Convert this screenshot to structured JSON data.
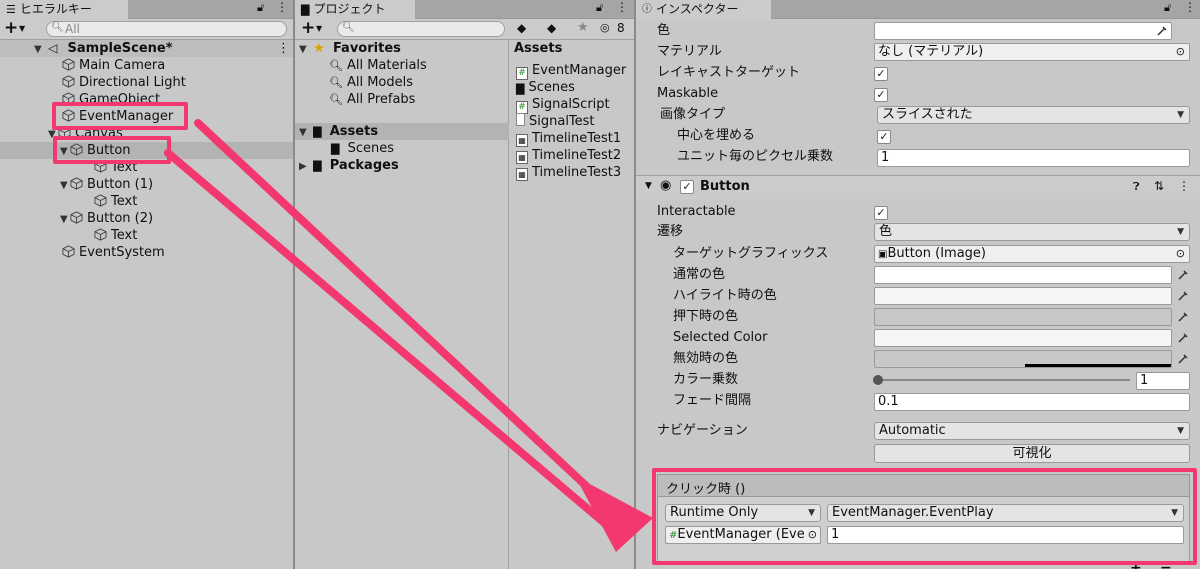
{
  "hierarchy": {
    "tab_label": "ヒエラルキー",
    "add_label": "+",
    "search_placeholder": "All",
    "scene_label": "SampleScene*",
    "items": [
      {
        "label": "Main Camera"
      },
      {
        "label": "Directional Light"
      },
      {
        "label": "GameObject"
      },
      {
        "label": "EventManager"
      },
      {
        "label": "Canvas"
      },
      {
        "label": "Button"
      },
      {
        "label": "Text"
      },
      {
        "label": "Button (1)"
      },
      {
        "label": "Text"
      },
      {
        "label": "Button (2)"
      },
      {
        "label": "Text"
      },
      {
        "label": "EventSystem"
      }
    ]
  },
  "project": {
    "tab_label": "プロジェクト",
    "add_label": "+",
    "badge_count": "8",
    "favorites_label": "Favorites",
    "favorites": [
      "All Materials",
      "All Models",
      "All Prefabs"
    ],
    "assets_label": "Assets",
    "assets_children": [
      "Scenes"
    ],
    "packages_label": "Packages",
    "breadcrumb": "Assets",
    "asset_items": [
      {
        "label": "EventManager",
        "icon": "script-icon"
      },
      {
        "label": "Scenes",
        "icon": "folder-icon"
      },
      {
        "label": "SignalScript",
        "icon": "script-icon"
      },
      {
        "label": "SignalTest",
        "icon": "file-icon"
      },
      {
        "label": "TimelineTest1",
        "icon": "timeline-icon"
      },
      {
        "label": "TimelineTest2",
        "icon": "timeline-icon"
      },
      {
        "label": "TimelineTest3",
        "icon": "timeline-icon"
      }
    ]
  },
  "inspector": {
    "tab_label": "インスペクター",
    "image": {
      "color_label": "色",
      "material_label": "マテリアル",
      "material_value": "なし (マテリアル)",
      "raycast_label": "レイキャストターゲット",
      "maskable_label": "Maskable",
      "image_type_label": "画像タイプ",
      "image_type_value": "スライスされた",
      "fill_center_label": "中心を埋める",
      "ppu_label": "ユニット毎のピクセル乗数",
      "ppu_value": "1"
    },
    "button": {
      "title": "Button",
      "interactable_label": "Interactable",
      "transition_label": "遷移",
      "transition_value": "色",
      "target_graphic_label": "ターゲットグラフィックス",
      "target_graphic_value": "Button (Image)",
      "normal_color_label": "通常の色",
      "highlight_color_label": "ハイライト時の色",
      "pressed_color_label": "押下時の色",
      "selected_color_label": "Selected Color",
      "disabled_color_label": "無効時の色",
      "color_multiplier_label": "カラー乗数",
      "color_multiplier_value": "1",
      "fade_label": "フェード間隔",
      "fade_value": "0.1",
      "navigation_label": "ナビゲーション",
      "navigation_value": "Automatic",
      "visualize_label": "可視化"
    },
    "onclick": {
      "header": "クリック時 ()",
      "runtime_value": "Runtime Only",
      "function_value": "EventManager.EventPlay",
      "object_value": "EventManager (Eve",
      "arg_value": "1"
    }
  },
  "colors": {
    "highlight": "#f2386f",
    "panel_bg": "#c8c8c8",
    "selection": "#b3b3b3"
  }
}
